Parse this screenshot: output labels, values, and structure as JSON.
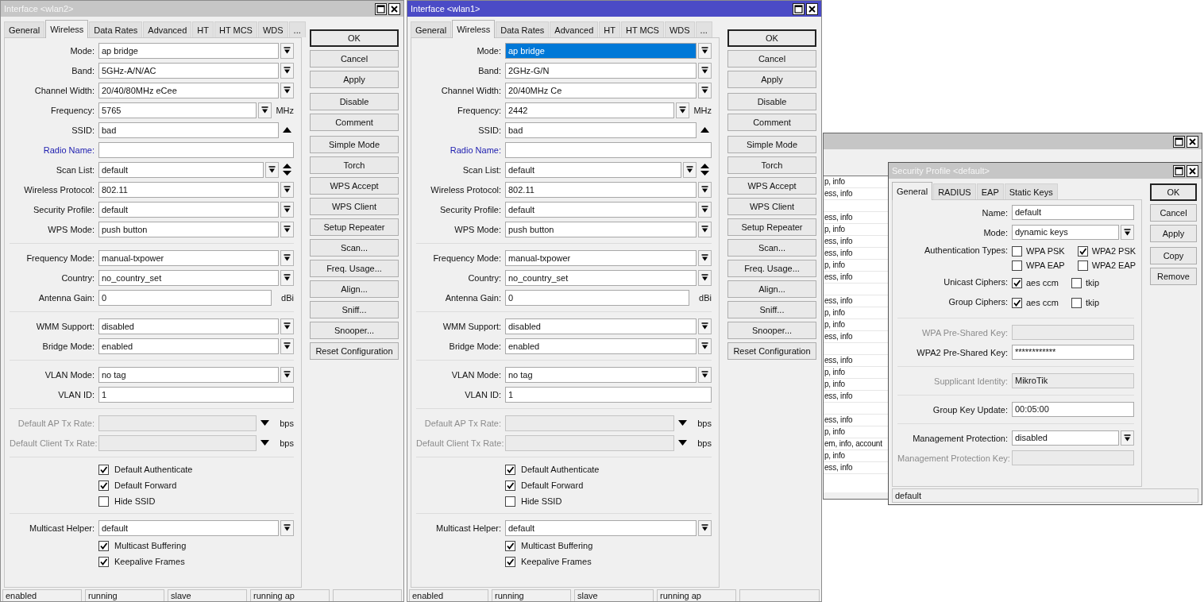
{
  "windows": [
    {
      "title": "Interface <wlan2>",
      "active": false,
      "tabs": [
        {
          "label": "General",
          "selected": false
        },
        {
          "label": "Wireless",
          "selected": true
        },
        {
          "label": "Data Rates",
          "selected": false
        },
        {
          "label": "Advanced",
          "selected": false
        },
        {
          "label": "HT",
          "selected": false
        },
        {
          "label": "HT MCS",
          "selected": false
        },
        {
          "label": "WDS",
          "selected": false
        },
        {
          "label": "...",
          "selected": false
        }
      ],
      "groups": [
        {
          "rows": [
            {
              "kind": "select",
              "label": "Mode:",
              "value": "ap bridge",
              "selected": false
            },
            {
              "kind": "select",
              "label": "Band:",
              "value": "5GHz-A/N/AC"
            },
            {
              "kind": "select",
              "label": "Channel Width:",
              "value": "20/40/80MHz eCee"
            },
            {
              "kind": "select_unit",
              "label": "Frequency:",
              "value": "5765",
              "unit": "MHz"
            },
            {
              "kind": "ssid",
              "label": "SSID:",
              "value": "bad"
            },
            {
              "kind": "text",
              "label": "Radio Name:",
              "link": true
            },
            {
              "kind": "scan",
              "label": "Scan List:",
              "value": "default"
            },
            {
              "kind": "select",
              "label": "Wireless Protocol:",
              "value": "802.11"
            },
            {
              "kind": "select",
              "label": "Security Profile:",
              "value": "default"
            },
            {
              "kind": "select",
              "label": "WPS Mode:",
              "value": "push button"
            }
          ]
        },
        {
          "rows": [
            {
              "kind": "select",
              "label": "Frequency Mode:",
              "value": "manual-txpower"
            },
            {
              "kind": "select",
              "label": "Country:",
              "value": "no_country_set"
            },
            {
              "kind": "text_unit",
              "label": "Antenna Gain:",
              "value": "0",
              "unit": "dBi"
            }
          ]
        },
        {
          "rows": [
            {
              "kind": "select",
              "label": "WMM Support:",
              "value": "disabled"
            },
            {
              "kind": "select",
              "label": "Bridge Mode:",
              "value": "enabled"
            }
          ]
        },
        {
          "rows": [
            {
              "kind": "select",
              "label": "VLAN Mode:",
              "value": "no tag"
            },
            {
              "kind": "text",
              "label": "VLAN ID:",
              "value": "1"
            }
          ]
        },
        {
          "rows": [
            {
              "kind": "rate",
              "label": "Default AP Tx Rate:",
              "unit": "bps",
              "disabled": true
            },
            {
              "kind": "rate",
              "label": "Default Client Tx Rate:",
              "unit": "bps",
              "disabled": true
            }
          ]
        },
        {
          "rows": [
            {
              "kind": "check",
              "text": "Default Authenticate",
              "checked": true
            },
            {
              "kind": "check",
              "text": "Default Forward",
              "checked": true
            },
            {
              "kind": "check",
              "text": "Hide SSID",
              "checked": false
            }
          ]
        },
        {
          "rows": [
            {
              "kind": "select",
              "label": "Multicast Helper:",
              "value": "default"
            },
            {
              "kind": "check",
              "text": "Multicast Buffering",
              "checked": true
            },
            {
              "kind": "check",
              "text": "Keepalive Frames",
              "checked": true
            }
          ]
        }
      ],
      "buttons": [
        [
          {
            "label": "OK",
            "default": true
          },
          {
            "label": "Cancel"
          },
          {
            "label": "Apply"
          }
        ],
        [
          {
            "label": "Disable"
          },
          {
            "label": "Comment"
          }
        ],
        [
          {
            "label": "Simple Mode"
          },
          {
            "label": "Torch"
          },
          {
            "label": "WPS Accept"
          },
          {
            "label": "WPS Client"
          },
          {
            "label": "Setup Repeater"
          },
          {
            "label": "Scan..."
          },
          {
            "label": "Freq. Usage..."
          },
          {
            "label": "Align..."
          },
          {
            "label": "Sniff..."
          },
          {
            "label": "Snooper..."
          },
          {
            "label": "Reset Configuration"
          }
        ]
      ],
      "status": [
        "enabled",
        "running",
        "slave",
        "running ap"
      ]
    },
    {
      "title": "Interface <wlan1>",
      "active": true,
      "tabs": [
        {
          "label": "General",
          "selected": false
        },
        {
          "label": "Wireless",
          "selected": true
        },
        {
          "label": "Data Rates",
          "selected": false
        },
        {
          "label": "Advanced",
          "selected": false
        },
        {
          "label": "HT",
          "selected": false
        },
        {
          "label": "HT MCS",
          "selected": false
        },
        {
          "label": "WDS",
          "selected": false
        },
        {
          "label": "...",
          "selected": false
        }
      ],
      "groups": [
        {
          "rows": [
            {
              "kind": "select",
              "label": "Mode:",
              "value": "ap bridge",
              "selected": true
            },
            {
              "kind": "select",
              "label": "Band:",
              "value": "2GHz-G/N"
            },
            {
              "kind": "select",
              "label": "Channel Width:",
              "value": "20/40MHz Ce"
            },
            {
              "kind": "select_unit",
              "label": "Frequency:",
              "value": "2442",
              "unit": "MHz"
            },
            {
              "kind": "ssid",
              "label": "SSID:",
              "value": "bad"
            },
            {
              "kind": "text",
              "label": "Radio Name:",
              "link": true
            },
            {
              "kind": "scan",
              "label": "Scan List:",
              "value": "default"
            },
            {
              "kind": "select",
              "label": "Wireless Protocol:",
              "value": "802.11"
            },
            {
              "kind": "select",
              "label": "Security Profile:",
              "value": "default"
            },
            {
              "kind": "select",
              "label": "WPS Mode:",
              "value": "push button"
            }
          ]
        },
        {
          "rows": [
            {
              "kind": "select",
              "label": "Frequency Mode:",
              "value": "manual-txpower"
            },
            {
              "kind": "select",
              "label": "Country:",
              "value": "no_country_set"
            },
            {
              "kind": "text_unit",
              "label": "Antenna Gain:",
              "value": "0",
              "unit": "dBi"
            }
          ]
        },
        {
          "rows": [
            {
              "kind": "select",
              "label": "WMM Support:",
              "value": "disabled"
            },
            {
              "kind": "select",
              "label": "Bridge Mode:",
              "value": "enabled"
            }
          ]
        },
        {
          "rows": [
            {
              "kind": "select",
              "label": "VLAN Mode:",
              "value": "no tag"
            },
            {
              "kind": "text",
              "label": "VLAN ID:",
              "value": "1"
            }
          ]
        },
        {
          "rows": [
            {
              "kind": "rate",
              "label": "Default AP Tx Rate:",
              "unit": "bps",
              "disabled": true
            },
            {
              "kind": "rate",
              "label": "Default Client Tx Rate:",
              "unit": "bps",
              "disabled": true
            }
          ]
        },
        {
          "rows": [
            {
              "kind": "check",
              "text": "Default Authenticate",
              "checked": true
            },
            {
              "kind": "check",
              "text": "Default Forward",
              "checked": true
            },
            {
              "kind": "check",
              "text": "Hide SSID",
              "checked": false
            }
          ]
        },
        {
          "rows": [
            {
              "kind": "select",
              "label": "Multicast Helper:",
              "value": "default"
            },
            {
              "kind": "check",
              "text": "Multicast Buffering",
              "checked": true
            },
            {
              "kind": "check",
              "text": "Keepalive Frames",
              "checked": true
            }
          ]
        }
      ],
      "buttons": [
        [
          {
            "label": "OK",
            "default": true
          },
          {
            "label": "Cancel"
          },
          {
            "label": "Apply"
          }
        ],
        [
          {
            "label": "Disable"
          },
          {
            "label": "Comment"
          }
        ],
        [
          {
            "label": "Simple Mode"
          },
          {
            "label": "Torch"
          },
          {
            "label": "WPS Accept"
          },
          {
            "label": "WPS Client"
          },
          {
            "label": "Setup Repeater"
          },
          {
            "label": "Scan..."
          },
          {
            "label": "Freq. Usage..."
          },
          {
            "label": "Align..."
          },
          {
            "label": "Sniff..."
          },
          {
            "label": "Snooper..."
          },
          {
            "label": "Reset Configuration"
          }
        ]
      ],
      "status": [
        "enabled",
        "running",
        "slave",
        "running ap"
      ]
    },
    {
      "title": "Security Profile <default>",
      "active": false,
      "tabs": [
        {
          "label": "General",
          "selected": true
        },
        {
          "label": "RADIUS",
          "selected": false
        },
        {
          "label": "EAP",
          "selected": false
        },
        {
          "label": "Static Keys",
          "selected": false
        }
      ],
      "groups": [
        {
          "rows": [
            {
              "kind": "text",
              "label": "Name:",
              "value": "default"
            },
            {
              "kind": "select",
              "label": "Mode:",
              "value": "dynamic keys"
            },
            {
              "kind": "checks",
              "label": "Authentication Types:",
              "options": [
                {
                  "text": "WPA PSK",
                  "checked": false
                },
                {
                  "text": "WPA2 PSK",
                  "checked": true
                },
                {
                  "text": "WPA EAP",
                  "checked": false
                },
                {
                  "text": "WPA2 EAP",
                  "checked": false
                }
              ]
            },
            {
              "kind": "checks",
              "label": "Unicast Ciphers:",
              "options": [
                {
                  "text": "aes ccm",
                  "checked": true
                },
                {
                  "text": "tkip",
                  "checked": false
                }
              ]
            },
            {
              "kind": "checks",
              "label": "Group Ciphers:",
              "options": [
                {
                  "text": "aes ccm",
                  "checked": true
                },
                {
                  "text": "tkip",
                  "checked": false
                }
              ]
            }
          ]
        },
        {
          "rows": [
            {
              "kind": "text",
              "label": "WPA Pre-Shared Key:",
              "disabled": true
            },
            {
              "kind": "text",
              "label": "WPA2 Pre-Shared Key:",
              "value": "************",
              "disabled": false
            }
          ]
        },
        {
          "rows": [
            {
              "kind": "text",
              "label": "Supplicant Identity:",
              "value": "MikroTik",
              "disabled": true
            }
          ]
        },
        {
          "rows": [
            {
              "kind": "text",
              "label": "Group Key Update:",
              "value": "00:05:00"
            }
          ]
        },
        {
          "rows": [
            {
              "kind": "select",
              "label": "Management Protection:",
              "value": "disabled"
            },
            {
              "kind": "text",
              "label": "Management Protection Key:",
              "disabled": true
            }
          ]
        }
      ],
      "buttons": [
        [
          {
            "label": "OK",
            "default": true
          },
          {
            "label": "Cancel"
          },
          {
            "label": "Apply"
          }
        ],
        [
          {
            "label": "Copy"
          },
          {
            "label": "Remove"
          }
        ]
      ],
      "status": [
        "default"
      ]
    }
  ],
  "log_window": {
    "active": false,
    "rows": [
      {
        "kind": "entry",
        "text": "p, info"
      },
      {
        "kind": "entry",
        "text": "ess, info"
      },
      {
        "kind": "blank"
      },
      {
        "kind": "entry",
        "text": "ess, info"
      },
      {
        "kind": "entry",
        "text": "p, info"
      },
      {
        "kind": "entry",
        "text": "ess, info"
      },
      {
        "kind": "entry",
        "text": "ess, info"
      },
      {
        "kind": "entry",
        "text": "p, info"
      },
      {
        "kind": "entry",
        "text": "ess, info"
      },
      {
        "kind": "blank"
      },
      {
        "kind": "entry",
        "text": "ess, info"
      },
      {
        "kind": "entry",
        "text": "p, info"
      },
      {
        "kind": "entry",
        "text": "p, info"
      },
      {
        "kind": "entry",
        "text": "ess, info"
      },
      {
        "kind": "blank"
      },
      {
        "kind": "entry",
        "text": "ess, info"
      },
      {
        "kind": "entry",
        "text": "p, info"
      },
      {
        "kind": "entry",
        "text": "p, info"
      },
      {
        "kind": "entry",
        "text": "ess, info"
      },
      {
        "kind": "blank"
      },
      {
        "kind": "entry",
        "text": "ess, info"
      },
      {
        "kind": "entry",
        "text": "p, info"
      },
      {
        "kind": "entry",
        "text": "em, info, account"
      },
      {
        "kind": "entry",
        "text": "p, info"
      },
      {
        "kind": "entry",
        "text": "ess, info"
      }
    ]
  }
}
